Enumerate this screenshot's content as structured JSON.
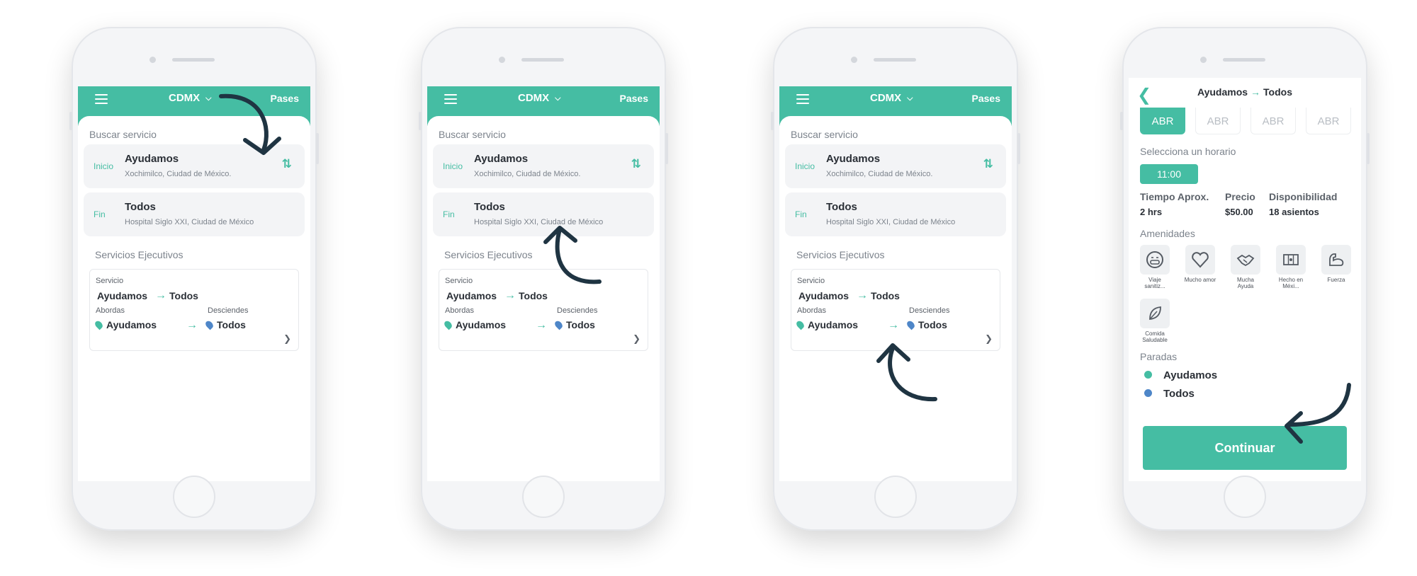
{
  "header": {
    "city": "CDMX",
    "pases": "Pases"
  },
  "search": {
    "title": "Buscar servicio"
  },
  "origin": {
    "tag": "Inicio",
    "name": "Ayudamos",
    "address": "Xochimilco, Ciudad de México."
  },
  "destination": {
    "tag": "Fin",
    "name": "Todos",
    "address": "Hospital Siglo XXI, Ciudad de México"
  },
  "services": {
    "title": "Servicios Ejecutivos",
    "service_label": "Servicio",
    "from": "Ayudamos",
    "to": "Todos",
    "board_label": "Abordas",
    "alight_label": "Desciendes",
    "board_stop": "Ayudamos",
    "alight_stop": "Todos"
  },
  "detail": {
    "title_from": "Ayudamos",
    "title_to": "Todos",
    "months": [
      "ABR",
      "ABR",
      "ABR",
      "ABR"
    ],
    "schedule_label": "Selecciona un horario",
    "time": "11:00",
    "duration_label": "Tiempo Aprox.",
    "duration": "2 hrs",
    "price_label": "Precio",
    "price": "$50.00",
    "availability_label": "Disponibilidad",
    "availability": "18 asientos",
    "amenities_label": "Amenidades",
    "amenities": [
      {
        "icon": "sanitized-face-icon",
        "label": "Viaje sanitiz..."
      },
      {
        "icon": "heart-icon",
        "label": "Mucho amor"
      },
      {
        "icon": "handshake-icon",
        "label": "Mucha Ayuda"
      },
      {
        "icon": "flag-icon",
        "label": "Hecho en Méxi..."
      },
      {
        "icon": "flexed-arm-icon",
        "label": "Fuerza"
      },
      {
        "icon": "leaf-icon",
        "label": "Comida Saludable"
      }
    ],
    "stops_label": "Paradas",
    "stops": [
      "Ayudamos",
      "Todos"
    ],
    "continue": "Continuar"
  },
  "colors": {
    "accent": "#45bda3",
    "stop_blue": "#4e86c8",
    "arrow": "#1f3442"
  }
}
